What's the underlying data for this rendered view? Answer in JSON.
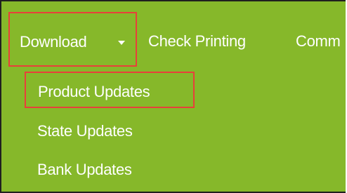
{
  "nav": {
    "download_label": "Download",
    "check_printing_label": "Check Printing",
    "comm_label": "Comm"
  },
  "download_menu": {
    "items": [
      {
        "label": "Product Updates"
      },
      {
        "label": "State Updates"
      },
      {
        "label": "Bank Updates"
      }
    ]
  },
  "colors": {
    "background": "#86b82a",
    "text": "#ffffff",
    "highlight_border": "#e8403a"
  },
  "icons": {
    "dropdown_caret": "chevron-down-icon"
  }
}
